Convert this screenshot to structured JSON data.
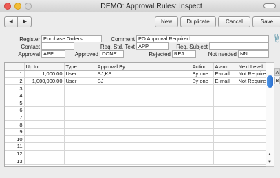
{
  "window": {
    "title": "DEMO: Approval Rules: Inspect"
  },
  "toolbar": {
    "prev_icon": "triangle-left",
    "next_icon": "triangle-right",
    "new_label": "New",
    "duplicate_label": "Duplicate",
    "cancel_label": "Cancel",
    "save_label": "Save"
  },
  "header": {
    "register_label": "Register",
    "register_value": "Purchase Orders",
    "comment_label": "Comment",
    "comment_value": "PO Approval Required",
    "contact_label": "Contact",
    "contact_value": "",
    "req_std_text_label": "Req. Std. Text",
    "req_std_text_value": "APP",
    "req_subject_label": "Req. Subject",
    "req_subject_value": "",
    "approval_label": "Approval",
    "approval_value": "APP",
    "approved_label": "Approved",
    "approved_value": "DONE",
    "rejected_label": "Rejected",
    "rejected_value": "REJ",
    "not_needed_label": "Not needed",
    "not_needed_value": "NN"
  },
  "table": {
    "columns": [
      "",
      "Up to",
      "Type",
      "Approval By",
      "Action",
      "Alarm",
      "Next Level"
    ],
    "rows": [
      [
        "1",
        "1,000.00",
        "User",
        "SJ,KS",
        "By one",
        "E-mail",
        "Not Required"
      ],
      [
        "2",
        "1,000,000.00",
        "User",
        "SJ",
        "By one",
        "E-mail",
        "Not Required"
      ],
      [
        "3",
        "",
        "",
        "",
        "",
        "",
        ""
      ],
      [
        "4",
        "",
        "",
        "",
        "",
        "",
        ""
      ],
      [
        "5",
        "",
        "",
        "",
        "",
        "",
        ""
      ],
      [
        "6",
        "",
        "",
        "",
        "",
        "",
        ""
      ],
      [
        "7",
        "",
        "",
        "",
        "",
        "",
        ""
      ],
      [
        "8",
        "",
        "",
        "",
        "",
        "",
        ""
      ],
      [
        "9",
        "",
        "",
        "",
        "",
        "",
        ""
      ],
      [
        "10",
        "",
        "",
        "",
        "",
        "",
        ""
      ],
      [
        "11",
        "",
        "",
        "",
        "",
        "",
        ""
      ],
      [
        "12",
        "",
        "",
        "",
        "",
        "",
        ""
      ],
      [
        "13",
        "",
        "",
        "",
        "",
        "",
        ""
      ]
    ]
  },
  "side_tabs": [
    "A",
    "B"
  ],
  "colors": {
    "close": "#ee5a54",
    "minimize": "#f3bd36",
    "scroll_thumb": "#2a6fd0"
  }
}
